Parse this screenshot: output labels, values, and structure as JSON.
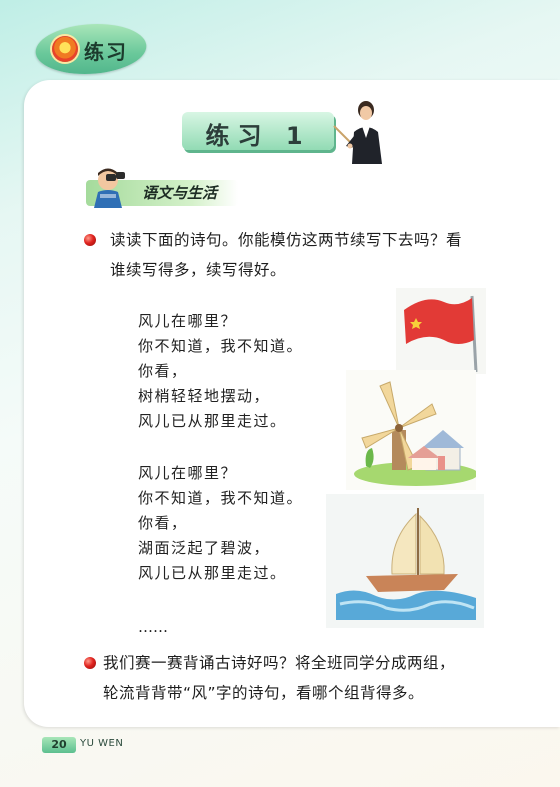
{
  "header": {
    "unit_title": "练习",
    "lesson_title": "练习 1"
  },
  "section": {
    "title": "语文与生活"
  },
  "exercise1": {
    "lines": [
      "读读下面的诗句。你能模仿这两节续写下去吗？看",
      "谁续写得多，续写得好。"
    ]
  },
  "poem": {
    "stanza1": [
      "风儿在哪里？",
      "你不知道，我不知道。",
      "你看，",
      "树梢轻轻地摆动，",
      "风儿已从那里走过。"
    ],
    "stanza2": [
      "风儿在哪里？",
      "你不知道，我不知道。",
      "你看，",
      "湖面泛起了碧波，",
      "风儿已从那里走过。"
    ],
    "ellipsis": "……"
  },
  "exercise2": {
    "lines": [
      "我们赛一赛背诵古诗好吗？将全班同学分成两组，",
      "轮流背背带“风”字的诗句，看哪个组背得多。"
    ]
  },
  "footer": {
    "page_number": "20",
    "label": "YU WEN"
  },
  "colors": {
    "accent_green": "#5cbf8f",
    "bullet_red": "#e0231f"
  },
  "icons": [
    "flower-icon",
    "teacher-illustration",
    "kid-binoculars-illustration",
    "flag-illustration",
    "windmill-illustration",
    "sailboat-illustration"
  ]
}
